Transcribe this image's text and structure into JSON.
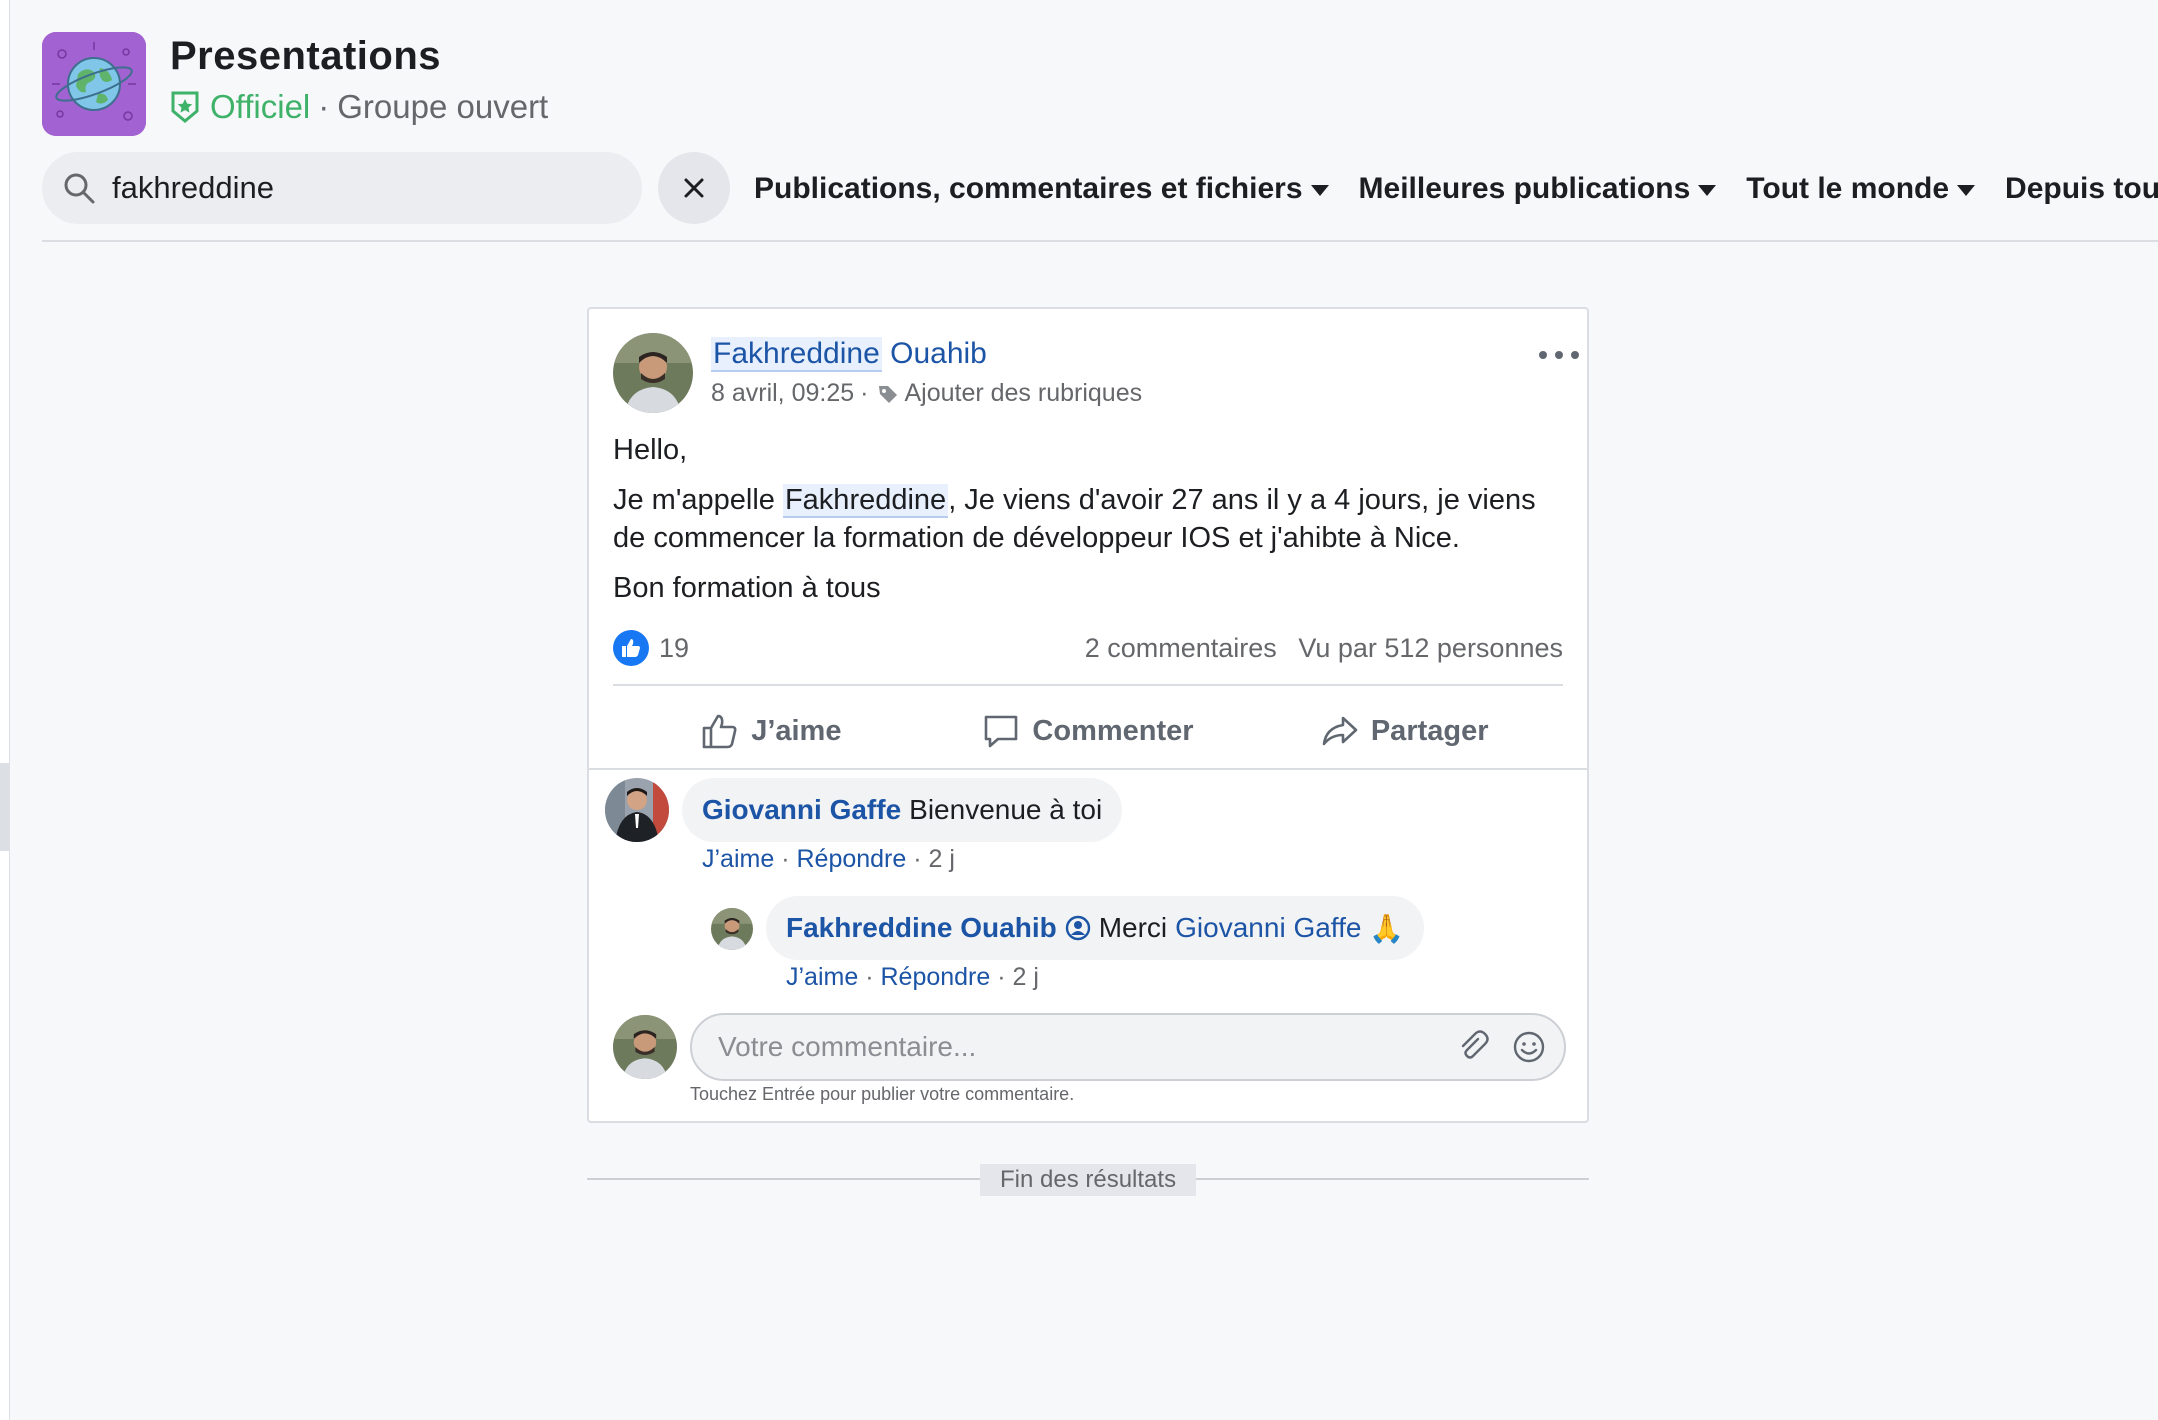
{
  "group": {
    "title": "Presentations",
    "official_label": "Officiel",
    "separator": "·",
    "privacy": "Groupe ouvert",
    "logo_icon": "globe-icon",
    "logo_color": "#a262d1"
  },
  "search": {
    "query": "fakhreddine",
    "placeholder": "",
    "clear_icon": "close-icon"
  },
  "filters": [
    {
      "label": "Publications, commentaires et fichiers"
    },
    {
      "label": "Meilleures publications"
    },
    {
      "label": "Tout le monde"
    },
    {
      "label": "Depuis toujours"
    }
  ],
  "post": {
    "author_first": "Fakhreddine",
    "author_last": "Ouahib",
    "timestamp": "8 avril, 09:25",
    "meta_separator": "·",
    "add_topics": "Ajouter des rubriques",
    "body": {
      "line1": "Hello,",
      "p2_before": "Je m'appelle ",
      "p2_highlight": "Fakhreddine",
      "p2_after": ", Je viens d'avoir 27 ans il y a 4 jours, je viens de commencer la formation de développeur IOS et j'ahibte à Nice.",
      "line3": "Bon formation à tous"
    },
    "like_count": "19",
    "comment_count": "2 commentaires",
    "seen_by": "Vu par 512 personnes",
    "actions": {
      "like": "J’aime",
      "comment": "Commenter",
      "share": "Partager"
    }
  },
  "comments": [
    {
      "author": "Giovanni Gaffe",
      "text": "Bienvenue à toi",
      "like": "J’aime",
      "reply": "Répondre",
      "sep": "·",
      "age": "2 j"
    }
  ],
  "reply": {
    "author": "Fakhreddine Ouahib",
    "text": "Merci",
    "mention": "Giovanni Gaffe",
    "emoji": "🙏",
    "like": "J’aime",
    "reply": "Répondre",
    "sep": "·",
    "age": "2 j"
  },
  "composer": {
    "placeholder": "Votre commentaire...",
    "hint": "Touchez Entrée pour publier votre commentaire."
  },
  "end_of_results": "Fin des résultats",
  "colors": {
    "link": "#1c54a6",
    "official": "#3fb26a",
    "like_blue": "#1877f2"
  }
}
